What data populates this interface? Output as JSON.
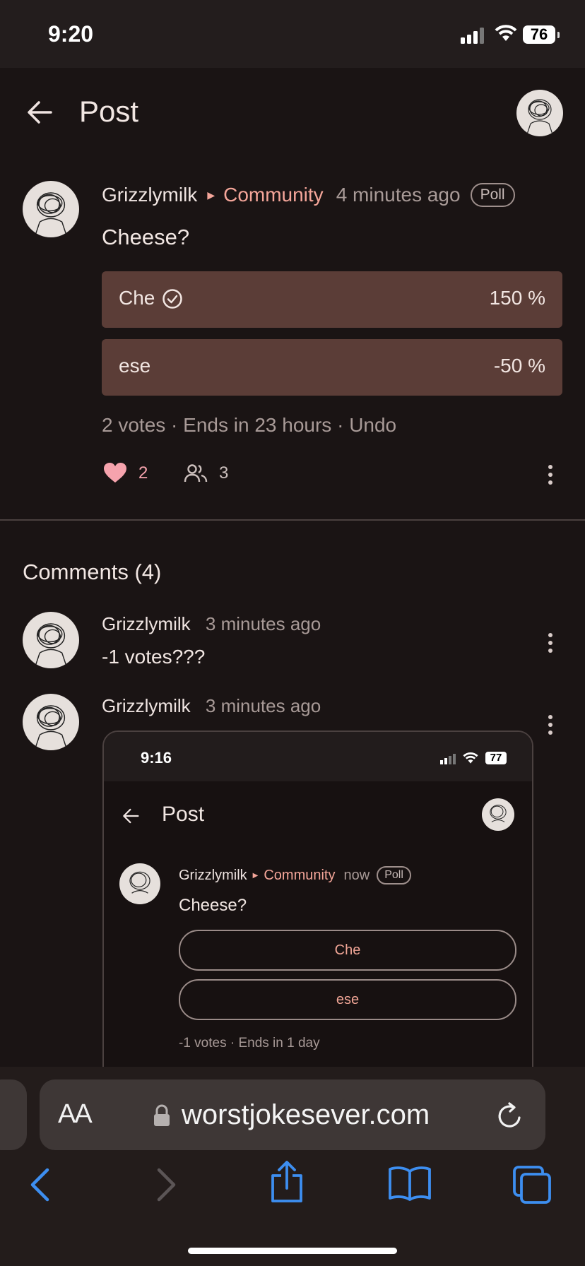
{
  "status_bar": {
    "time": "9:20",
    "battery": "76"
  },
  "header": {
    "title": "Post"
  },
  "post": {
    "author": "Grizzlymilk",
    "community": "Community",
    "time_ago": "4 minutes ago",
    "badge": "Poll",
    "title": "Cheese?",
    "options": [
      {
        "label": "Che",
        "percent": "150 %",
        "selected": true
      },
      {
        "label": "ese",
        "percent": "-50 %",
        "selected": false
      }
    ],
    "meta": "2 votes · Ends in 23 hours · ",
    "undo": "Undo",
    "likes": "2",
    "participants": "3"
  },
  "comments": {
    "heading": "Comments (4)",
    "items": [
      {
        "author": "Grizzlymilk",
        "time_ago": "3 minutes ago",
        "text": "-1 votes???"
      },
      {
        "author": "Grizzlymilk",
        "time_ago": "3 minutes ago",
        "text": ""
      }
    ]
  },
  "embedded_screenshot": {
    "time": "9:16",
    "battery": "77",
    "header_title": "Post",
    "author": "Grizzlymilk",
    "community": "Community",
    "time_ago": "now",
    "badge": "Poll",
    "title": "Cheese?",
    "options": [
      "Che",
      "ese"
    ],
    "meta": "-1 votes · Ends in 1 day"
  },
  "browser": {
    "text_size_label": "AA",
    "url": "worstjokesever.com"
  },
  "colors": {
    "accent": "#f5a69a",
    "poll_fill": "#5b3d37",
    "background": "#1a1414",
    "link_blue": "#3d8ef0"
  }
}
